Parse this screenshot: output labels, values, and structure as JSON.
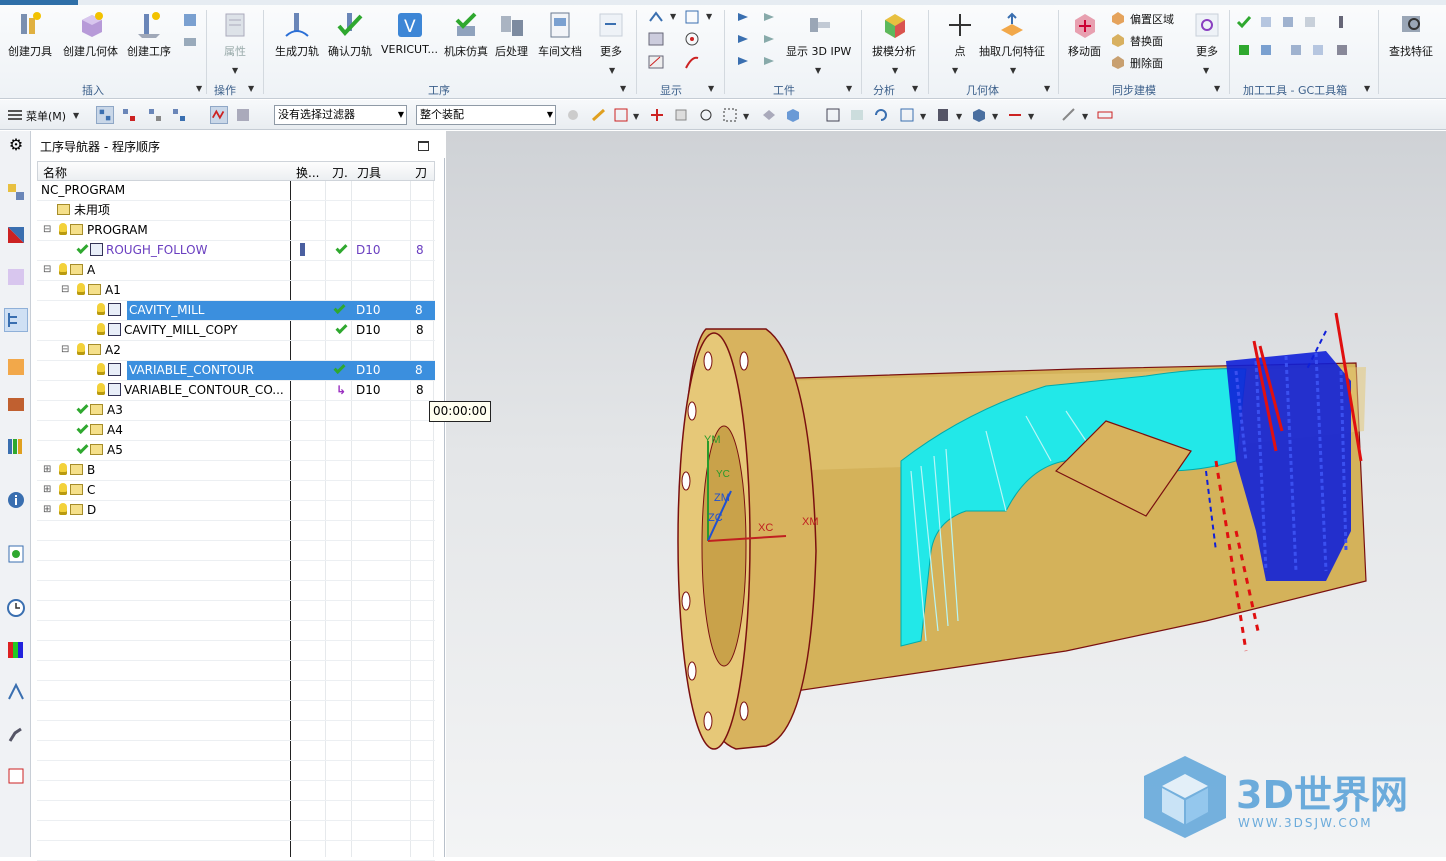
{
  "ribbon": {
    "buttons": [
      {
        "id": "create-tool",
        "label": "创建刀具"
      },
      {
        "id": "create-geometry",
        "label": "创建几何体"
      },
      {
        "id": "create-operation",
        "label": "创建工序"
      },
      {
        "id": "properties",
        "label": "属性"
      },
      {
        "id": "generate-toolpath",
        "label": "生成刀轨"
      },
      {
        "id": "verify-toolpath",
        "label": "确认刀轨"
      },
      {
        "id": "vericut",
        "label": "VERICUT..."
      },
      {
        "id": "machine-sim",
        "label": "机床仿真"
      },
      {
        "id": "postprocess",
        "label": "后处理"
      },
      {
        "id": "shop-doc",
        "label": "车间文档"
      },
      {
        "id": "more-ops",
        "label": "更多"
      },
      {
        "id": "show-3d-ipw",
        "label": "显示 3D IPW"
      },
      {
        "id": "draft-analysis",
        "label": "拔模分析"
      },
      {
        "id": "point",
        "label": "点"
      },
      {
        "id": "extract-geometry",
        "label": "抽取几何特征"
      },
      {
        "id": "move-face",
        "label": "移动面"
      },
      {
        "id": "more-sync",
        "label": "更多"
      },
      {
        "id": "find-feature",
        "label": "查找特征"
      }
    ],
    "sync_small": [
      "偏置区域",
      "替换面",
      "删除面"
    ],
    "groups": [
      "插入",
      "操作",
      "工序",
      "显示",
      "工件",
      "分析",
      "几何体",
      "同步建模",
      "加工工具 - GC工具箱"
    ]
  },
  "toolbar": {
    "menu_label": "菜单(M)",
    "filter_value": "没有选择过滤器",
    "assembly_value": "整个装配"
  },
  "navigator": {
    "title": "工序导航器 - 程序顺序",
    "columns": [
      "名称",
      "换...",
      "刀.",
      "刀具",
      "刀"
    ],
    "rows": [
      {
        "name": "NC_PROGRAM",
        "tool": "",
        "num": ""
      },
      {
        "name": "未用项",
        "tool": "",
        "num": ""
      },
      {
        "name": "PROGRAM",
        "tool": "",
        "num": ""
      },
      {
        "name": "ROUGH_FOLLOW",
        "tool": "D10",
        "num": "8"
      },
      {
        "name": "A",
        "tool": "",
        "num": ""
      },
      {
        "name": "A1",
        "tool": "",
        "num": ""
      },
      {
        "name": "CAVITY_MILL",
        "tool": "D10",
        "num": "8"
      },
      {
        "name": "CAVITY_MILL_COPY",
        "tool": "D10",
        "num": "8"
      },
      {
        "name": "A2",
        "tool": "",
        "num": ""
      },
      {
        "name": "VARIABLE_CONTOUR",
        "tool": "D10",
        "num": "8"
      },
      {
        "name": "VARIABLE_CONTOUR_CO...",
        "tool": "D10",
        "num": "8"
      },
      {
        "name": "A3",
        "tool": "",
        "num": ""
      },
      {
        "name": "A4",
        "tool": "",
        "num": ""
      },
      {
        "name": "A5",
        "tool": "",
        "num": ""
      },
      {
        "name": "B",
        "tool": "",
        "num": ""
      },
      {
        "name": "C",
        "tool": "",
        "num": ""
      },
      {
        "name": "D",
        "tool": "",
        "num": ""
      }
    ],
    "tooltip": "00:00:00"
  },
  "viewport": {
    "axis_labels": [
      "YM",
      "YC",
      "ZM",
      "ZC",
      "XC",
      "XM"
    ]
  },
  "watermark": {
    "brand": "3D世界网",
    "url": "WWW.3DSJW.COM"
  },
  "colors": {
    "selection": "#3b8fde",
    "part": "#d4b25a",
    "toolpath_cyan": "#22e8e8",
    "toolpath_blue": "#1020d8",
    "group_label": "#3b5f8a"
  }
}
